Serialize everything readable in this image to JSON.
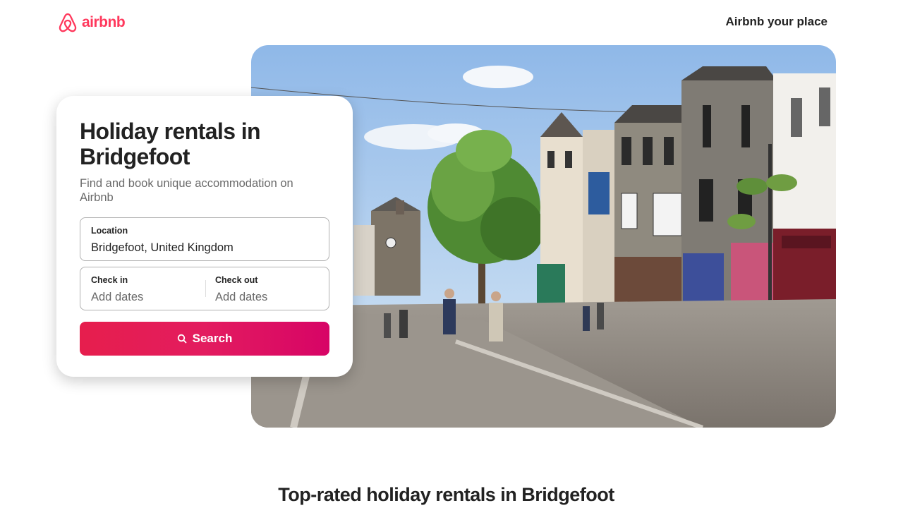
{
  "header": {
    "logo_text": "airbnb",
    "host_link": "Airbnb your place",
    "brand_color": "#FF385C"
  },
  "hero": {
    "image_subject": "town-street-photo"
  },
  "search_card": {
    "title": "Holiday rentals in Bridgefoot",
    "subtitle": "Find and book unique accommodation on Airbnb",
    "location": {
      "label": "Location",
      "value": "Bridgefoot, United Kingdom"
    },
    "check_in": {
      "label": "Check in",
      "placeholder": "Add dates"
    },
    "check_out": {
      "label": "Check out",
      "placeholder": "Add dates"
    },
    "search_button": {
      "label": "Search",
      "icon": "search-icon",
      "gradient": [
        "#E61E4D",
        "#E31C5F",
        "#D70466"
      ]
    }
  },
  "section": {
    "title": "Top-rated holiday rentals in Bridgefoot"
  }
}
